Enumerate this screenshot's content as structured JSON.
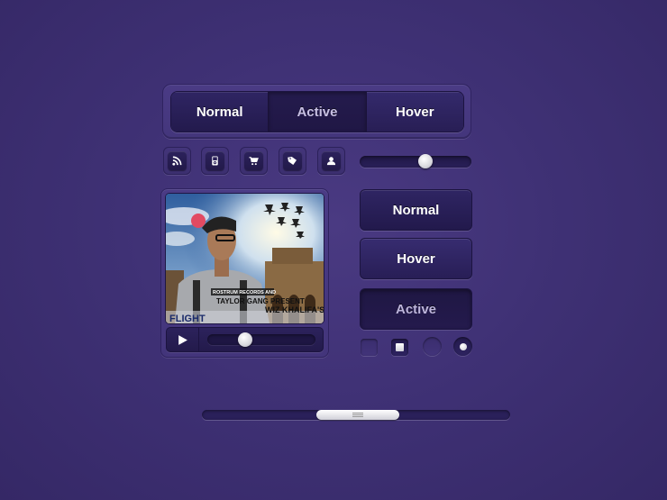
{
  "segmented_control": {
    "items": [
      {
        "label": "Normal",
        "state": "normal"
      },
      {
        "label": "Active",
        "state": "active"
      },
      {
        "label": "Hover",
        "state": "hover"
      }
    ]
  },
  "icon_buttons": [
    {
      "icon": "rss-icon"
    },
    {
      "icon": "ipod-icon"
    },
    {
      "icon": "cart-icon"
    },
    {
      "icon": "tag-icon"
    },
    {
      "icon": "user-icon"
    }
  ],
  "slider": {
    "value_percent": 60
  },
  "player": {
    "cover_texts": {
      "line1": "ROSTRUM RECORDS AND",
      "line2": "TAYLOR GANG PRESENT",
      "artist": "WIZ KHALIFA'S",
      "title": "FLIGHT"
    },
    "play_icon": "play-icon",
    "seek_percent": 33
  },
  "buttons": [
    {
      "label": "Normal",
      "state": "normal"
    },
    {
      "label": "Hover",
      "state": "hover"
    },
    {
      "label": "Active",
      "state": "active"
    }
  ],
  "checkboxes": [
    {
      "checked": false
    },
    {
      "checked": true
    }
  ],
  "radios": [
    {
      "checked": false
    },
    {
      "checked": true
    }
  ],
  "scrollbar": {
    "thumb_start_percent": 37,
    "thumb_size_percent": 27
  },
  "colors": {
    "background": "#3f3175",
    "button_dark": "#231a4d",
    "text": "#ffffff",
    "active_text": "#c8c0e4"
  }
}
